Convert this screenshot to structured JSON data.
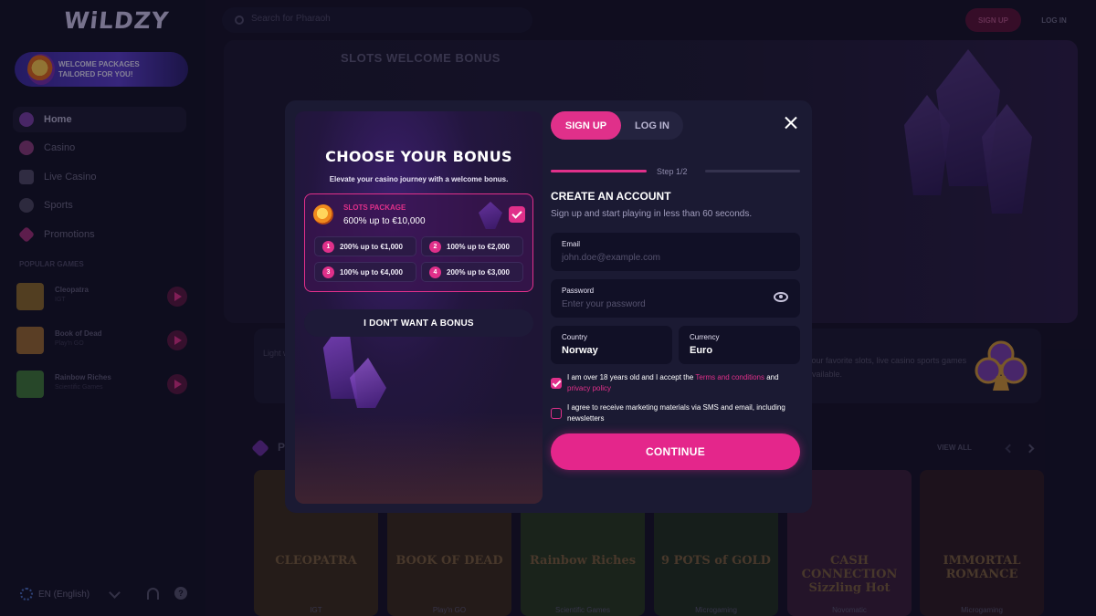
{
  "app": {
    "logo_text": "WiLDZY",
    "promo_text": "WELCOME PACKAGES TAILORED FOR YOU!",
    "search_placeholder": "Search for Pharaoh",
    "signup_label": "SIGN UP",
    "login_label": "LOG IN"
  },
  "sidebar": {
    "nav": [
      {
        "label": "Home",
        "icon": "home-icon",
        "color": "#7b3fa8"
      },
      {
        "label": "Casino",
        "icon": "casino-icon",
        "color": "#8a3b7c"
      },
      {
        "label": "Live Casino",
        "icon": "live-casino-icon",
        "color": "#7a7290"
      },
      {
        "label": "Sports",
        "icon": "sports-icon",
        "color": "#6c6882"
      },
      {
        "label": "Promotions",
        "icon": "promotions-icon",
        "color": "#a02f78"
      }
    ],
    "popular_title": "POPULAR GAMES",
    "popular_games": [
      {
        "name": "Cleopatra",
        "provider": "IGT",
        "thumb_color": "#8c6a2a"
      },
      {
        "name": "Book of Dead",
        "provider": "Play'n GO",
        "thumb_color": "#9b6a32"
      },
      {
        "name": "Rainbow Riches",
        "provider": "Scientific Games",
        "thumb_color": "#3f7a3a"
      }
    ],
    "language": "EN (English)"
  },
  "hero": {
    "title": "SLOTS WELCOME BONUS"
  },
  "info_card": {
    "left_text": "Light with meth",
    "right_text": "your favorite slots, live casino sports games available."
  },
  "section": {
    "title": "P",
    "view_all": "VIEW ALL"
  },
  "game_cards": [
    {
      "title": "CLEOPATRA",
      "provider": "IGT",
      "bg": "#3b2c1d"
    },
    {
      "title": "BOOK OF DEAD",
      "provider": "Play'n GO",
      "bg": "#3a2a1c"
    },
    {
      "title": "Rainbow Riches",
      "provider": "Scientific Games",
      "bg": "#27391f"
    },
    {
      "title": "9 POTS of GOLD",
      "provider": "Microgaming",
      "bg": "#1f3020"
    },
    {
      "title": "CASH CONNECTION Sizzling Hot",
      "provider": "Novomatic",
      "bg": "#3a1e3a"
    },
    {
      "title": "IMMORTAL ROMANCE",
      "provider": "Microgaming",
      "bg": "#2d1b22"
    }
  ],
  "modal": {
    "bonus": {
      "title": "CHOOSE YOUR BONUS",
      "subtitle": "Elevate your casino journey with a welcome bonus.",
      "package_name": "SLOTS PACKAGE",
      "package_amount": "600% up to €10,000",
      "tiers": [
        {
          "num": "1",
          "text": "200% up to €1,000"
        },
        {
          "num": "2",
          "text": "100% up to €2,000"
        },
        {
          "num": "3",
          "text": "100% up to €4,000"
        },
        {
          "num": "4",
          "text": "200% up to €3,000"
        }
      ],
      "no_bonus_label": "I DON'T WANT A BONUS"
    },
    "form": {
      "tab_signup": "SIGN UP",
      "tab_login": "LOG IN",
      "step_label": "Step 1/2",
      "step_current": 1,
      "step_total": 2,
      "title": "CREATE AN ACCOUNT",
      "subtitle": "Sign up and start playing in less than 60 seconds.",
      "email_label": "Email",
      "email_placeholder": "john.doe@example.com",
      "password_label": "Password",
      "password_placeholder": "Enter your password",
      "country_label": "Country",
      "country_value": "Norway",
      "currency_label": "Currency",
      "currency_value": "Euro",
      "consent_age_prefix": "I am over 18 years old and I accept the",
      "consent_age_link1": "Terms and conditions",
      "consent_age_and": "and",
      "consent_age_link2": "privacy policy",
      "consent_age_checked": true,
      "consent_marketing": "I agree to receive marketing materials via SMS and email, including newsletters",
      "consent_marketing_checked": false,
      "continue_label": "CONTINUE"
    }
  },
  "colors": {
    "accent": "#e0308a",
    "background": "#141227",
    "modal": "#1b1a33"
  }
}
